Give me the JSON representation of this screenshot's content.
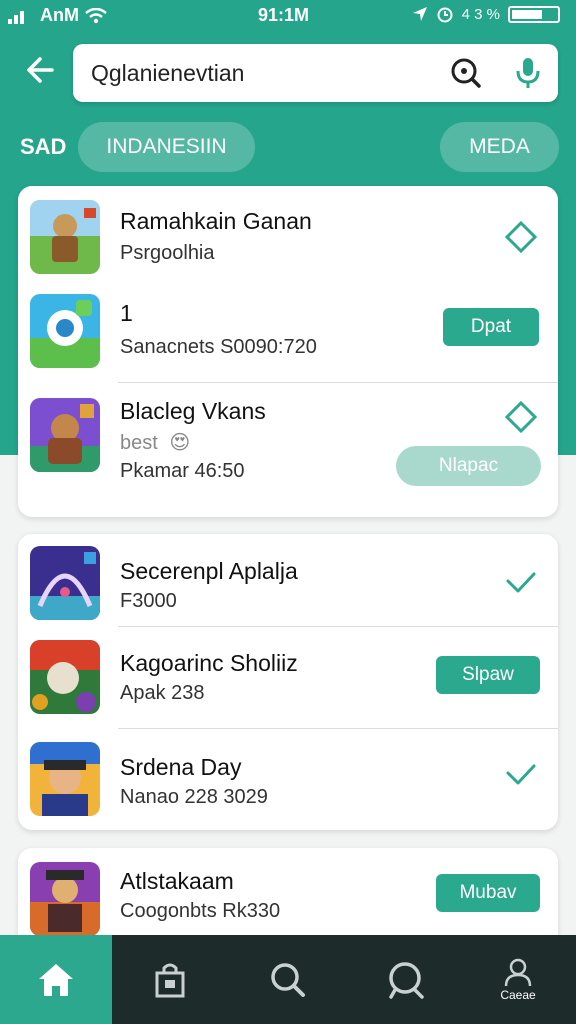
{
  "status_bar": {
    "carrier": "AnM",
    "time": "91:1M",
    "battery_text": "4 3 %"
  },
  "search": {
    "query": "Qglanienevtian"
  },
  "chips": {
    "row_label": "SAD",
    "chip1": "INDANESIIN",
    "chip2": "MEDA"
  },
  "cards": [
    {
      "rows": [
        {
          "title": "Ramahkain Ganan",
          "subtitle": "Psrgoolhia",
          "action": "diamond"
        },
        {
          "title": "1",
          "subtitle": "Sanacnets  S0090:720",
          "action_label": "Dpat"
        },
        {
          "title": "Blacleg Vkans",
          "subtitle": "best",
          "emoji": "😍",
          "subtitle2": "Pkamar  46:50",
          "action_label": "Nlapac"
        }
      ]
    },
    {
      "rows": [
        {
          "title": "Secerenpl Aplalja",
          "subtitle": "F3000",
          "action": "check"
        },
        {
          "title": "Kagoarinc Sholiiz",
          "subtitle": "Apak  238",
          "action_label": "Slpaw"
        },
        {
          "title": "Srdena Day",
          "subtitle": "Nanao  228 3029",
          "action": "check"
        }
      ]
    },
    {
      "rows": [
        {
          "title": "Atlstakaam",
          "subtitle": "Coogonbts  Rk330",
          "action_label": "Mubav"
        }
      ]
    }
  ],
  "tab_bar": {
    "tabs": [
      {
        "icon": "home-icon"
      },
      {
        "icon": "store-icon"
      },
      {
        "icon": "search-icon"
      },
      {
        "icon": "explore-icon"
      },
      {
        "icon": "profile-icon",
        "label": "Caeae"
      }
    ]
  },
  "colors": {
    "accent": "#25a58b",
    "button": "#2aa98e",
    "tab_bar": "#1d2b2b"
  }
}
